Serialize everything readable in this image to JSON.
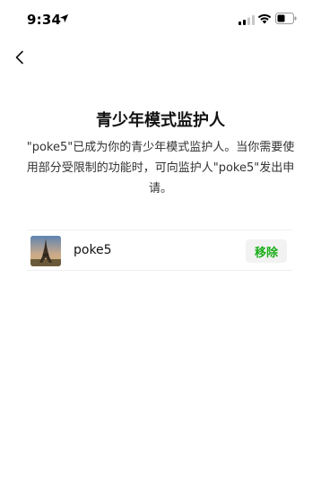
{
  "status_bar": {
    "time": "9:34"
  },
  "page": {
    "title": "青少年模式监护人",
    "description": "\"poke5\"已成为你的青少年模式监护人。当你需要使用部分受限制的功能时，可向监护人\"poke5\"发出申请。"
  },
  "guardian": {
    "name": "poke5",
    "remove_label": "移除"
  },
  "colors": {
    "accent": "#1aad19",
    "background": "#ffffff"
  },
  "icons": {
    "back": "chevron-left-icon",
    "location": "location-arrow-icon",
    "signal": "cellular-signal-icon",
    "wifi": "wifi-icon",
    "battery": "battery-icon"
  }
}
